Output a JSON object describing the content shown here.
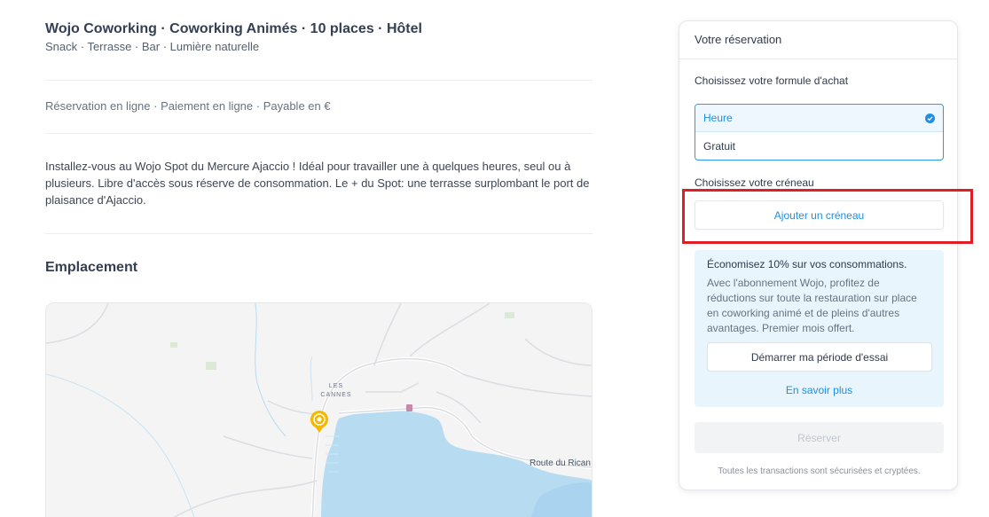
{
  "listing": {
    "title": "Wojo Coworking · Coworking Animés · 10 places · Hôtel",
    "amenities": "Snack · Terrasse · Bar · Lumière naturelle",
    "payment_info": "Réservation en ligne · Paiement en ligne · Payable en €",
    "description": "Installez-vous au Wojo Spot du Mercure Ajaccio ! Idéal pour travailler une à quelques heures, seul ou à plusieurs. Libre d'accès sous réserve de consommation. Le + du Spot: une terrasse surplombant le port de plaisance d'Ajaccio.",
    "location_heading": "Emplacement"
  },
  "map": {
    "district_label_line1": "LES",
    "district_label_line2": "CANNES",
    "road_label": "Route du Rican",
    "pin_icon": "location-pin-icon",
    "accent_color": "#f5b800",
    "water_color": "#b7dcf2"
  },
  "reservation": {
    "header": "Votre réservation",
    "formula_label": "Choisissez votre formule d'achat",
    "options": [
      {
        "label": "Heure",
        "selected": true
      },
      {
        "label": "Gratuit",
        "selected": false
      }
    ],
    "slot_label": "Choisissez votre créneau",
    "add_slot_button": "Ajouter un créneau",
    "promo": {
      "title": "Économisez 10% sur vos consommations.",
      "text": "Avec l'abonnement Wojo, profitez de réductions sur toute la restauration sur place en coworking animé et de pleins d'autres avantages. Premier mois offert.",
      "trial_button": "Démarrer ma période d'essai",
      "learn_more_link": "En savoir plus"
    },
    "reserve_button": "Réserver",
    "secure_note": "Toutes les transactions sont sécurisées et cryptées.",
    "accent_color": "#1e8fe1"
  },
  "highlight_color": "#e01e25"
}
